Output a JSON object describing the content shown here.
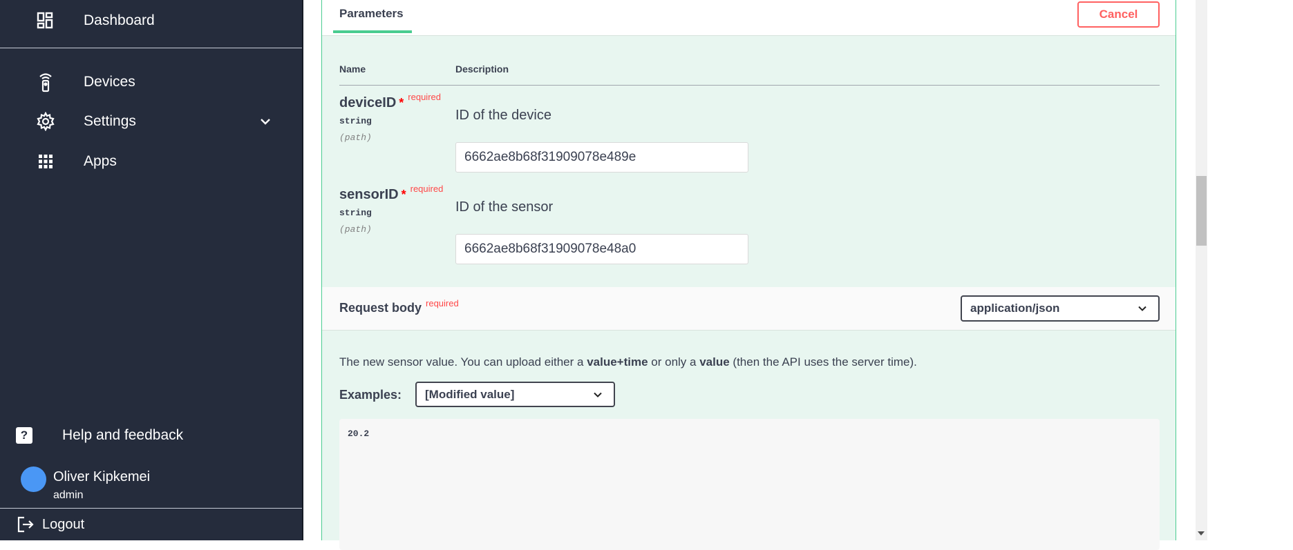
{
  "sidebar": {
    "items": [
      {
        "label": "Dashboard",
        "icon": "dashboard-icon"
      },
      {
        "label": "Devices",
        "icon": "remote-icon"
      },
      {
        "label": "Settings",
        "icon": "gear-icon"
      },
      {
        "label": "Apps",
        "icon": "apps-grid-icon"
      }
    ],
    "help_label": "Help and feedback",
    "user": {
      "name": "Oliver Kipkemei",
      "role": "admin"
    },
    "logout_label": "Logout"
  },
  "panel": {
    "tab_label": "Parameters",
    "cancel_label": "Cancel",
    "columns": {
      "name": "Name",
      "description": "Description"
    },
    "params": [
      {
        "name": "deviceID",
        "star": "*",
        "required": "required",
        "type": "string",
        "in": "(path)",
        "description": "ID of the device",
        "value": "6662ae8b68f31909078e489e"
      },
      {
        "name": "sensorID",
        "star": "*",
        "required": "required",
        "type": "string",
        "in": "(path)",
        "description": "ID of the sensor",
        "value": "6662ae8b68f31909078e48a0"
      }
    ],
    "request_body": {
      "title": "Request body",
      "required": "required",
      "content_type": "application/json",
      "desc_parts": [
        "The new sensor value. You can upload either a ",
        "value+time",
        " or only a ",
        "value",
        " (then the API uses the server time)."
      ],
      "examples_label": "Examples:",
      "example_selected": "[Modified value]",
      "body_value": "20.2"
    }
  },
  "colors": {
    "sidebar_bg": "#252c3c",
    "accent_green": "#49cc90",
    "cancel_red": "#ff6060",
    "avatar_blue": "#4a97f5"
  }
}
